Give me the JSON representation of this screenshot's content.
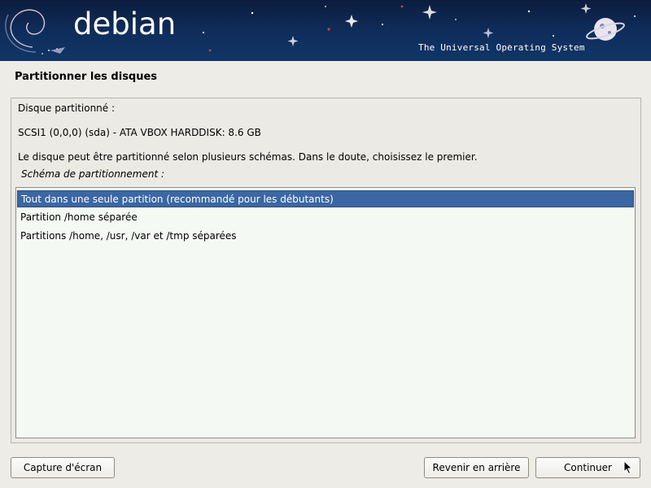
{
  "banner": {
    "brand": "debian",
    "tagline": "The Universal Operating System"
  },
  "page": {
    "title": "Partitionner les disques"
  },
  "content": {
    "disk_label": "Disque partitionné :",
    "disk_value": "SCSI1 (0,0,0) (sda) - ATA VBOX HARDDISK: 8.6 GB",
    "description": "Le disque peut être partitionné selon plusieurs schémas. Dans le doute, choisissez le premier.",
    "list_caption": "Schéma de partitionnement :",
    "options": [
      {
        "label": "Tout dans une seule partition (recommandé pour les débutants)",
        "selected": true
      },
      {
        "label": "Partition /home séparée",
        "selected": false
      },
      {
        "label": "Partitions /home, /usr, /var et /tmp séparées",
        "selected": false
      }
    ]
  },
  "buttons": {
    "screenshot": "Capture d'écran",
    "back": "Revenir en arrière",
    "continue": "Continuer"
  },
  "colors": {
    "selection": "#3b67a3",
    "banner": "#0f2e5c",
    "background": "#edece6"
  },
  "icons": [
    "debian-swirl-logo",
    "planet-icon",
    "mouse-cursor-icon"
  ]
}
